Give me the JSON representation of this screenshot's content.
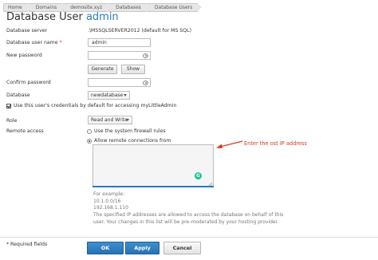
{
  "breadcrumb": [
    "Home",
    "Domains",
    "demosite.xyz",
    "Databases",
    "Database Users"
  ],
  "title": {
    "prefix": "Database User",
    "name": "admin"
  },
  "fields": {
    "database_server": {
      "label": "Database server",
      "value": ".\\MSSQLSERVER2012 (default for MS SQL)"
    },
    "user_name": {
      "label": "Database user name",
      "required_mark": "*",
      "value": "admin"
    },
    "new_password": {
      "label": "New password",
      "value": ""
    },
    "confirm_password": {
      "label": "Confirm password",
      "value": ""
    },
    "database": {
      "label": "Database",
      "selected": "newdatabase"
    },
    "role": {
      "label": "Role",
      "selected": "Read and Write"
    },
    "remote_access": {
      "label": "Remote access"
    }
  },
  "buttons": {
    "generate": "Generate",
    "show": "Show",
    "ok": "OK",
    "apply": "Apply",
    "cancel": "Cancel"
  },
  "default_credentials": {
    "label": "Use this user's credentials by default for accessing myLittleAdmin",
    "checked": true
  },
  "remote_options": [
    {
      "label": "Use the system firewall rules",
      "selected": false
    },
    {
      "label": "Allow remote connections from",
      "selected": true
    }
  ],
  "ip_textarea": {
    "value": ""
  },
  "annotation": "Enter the ost IP address",
  "hints": {
    "example_heading": "For example:",
    "example_1": "10.1.0.0/16",
    "example_2": "192.168.1.110",
    "note_line1": "The specified IP addresses are allowed to access the database on behalf of this",
    "note_line2": "user. Your changes in this list will be pre-moderated by your hosting provider."
  },
  "footer": {
    "required_note": "* Required fields"
  },
  "colors": {
    "accent": "#2a7ab8",
    "annotation": "#d9391f",
    "primary_button": "#2a72b3"
  },
  "icons": {
    "password_toggle": "eye-icon",
    "grammar_assistant": "grammarly-icon"
  }
}
